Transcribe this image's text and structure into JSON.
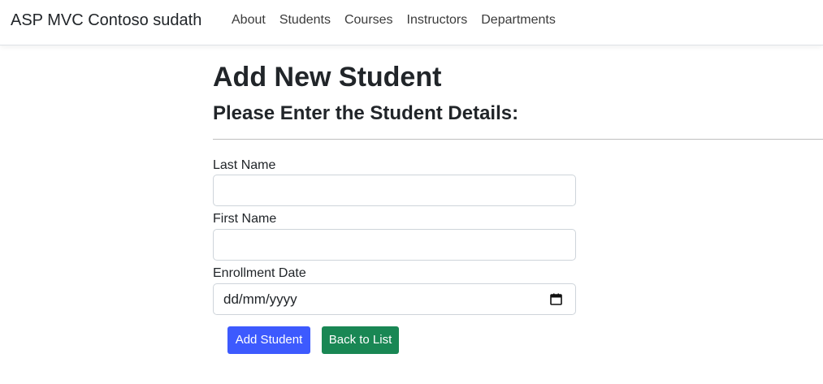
{
  "navbar": {
    "brand": "ASP MVC Contoso sudath",
    "links": [
      "About",
      "Students",
      "Courses",
      "Instructors",
      "Departments"
    ]
  },
  "page": {
    "title": "Add New Student",
    "subtitle": "Please Enter the Student Details:"
  },
  "form": {
    "last_name": {
      "label": "Last Name",
      "value": ""
    },
    "first_name": {
      "label": "First Name",
      "value": ""
    },
    "enrollment_date": {
      "label": "Enrollment Date",
      "placeholder": "dd/mm/yyyy",
      "icon": "calendar-icon"
    }
  },
  "buttons": {
    "add_student": "Add Student",
    "back_to_list": "Back to List"
  },
  "colors": {
    "primary": "#3d5afe",
    "success": "#198754"
  }
}
